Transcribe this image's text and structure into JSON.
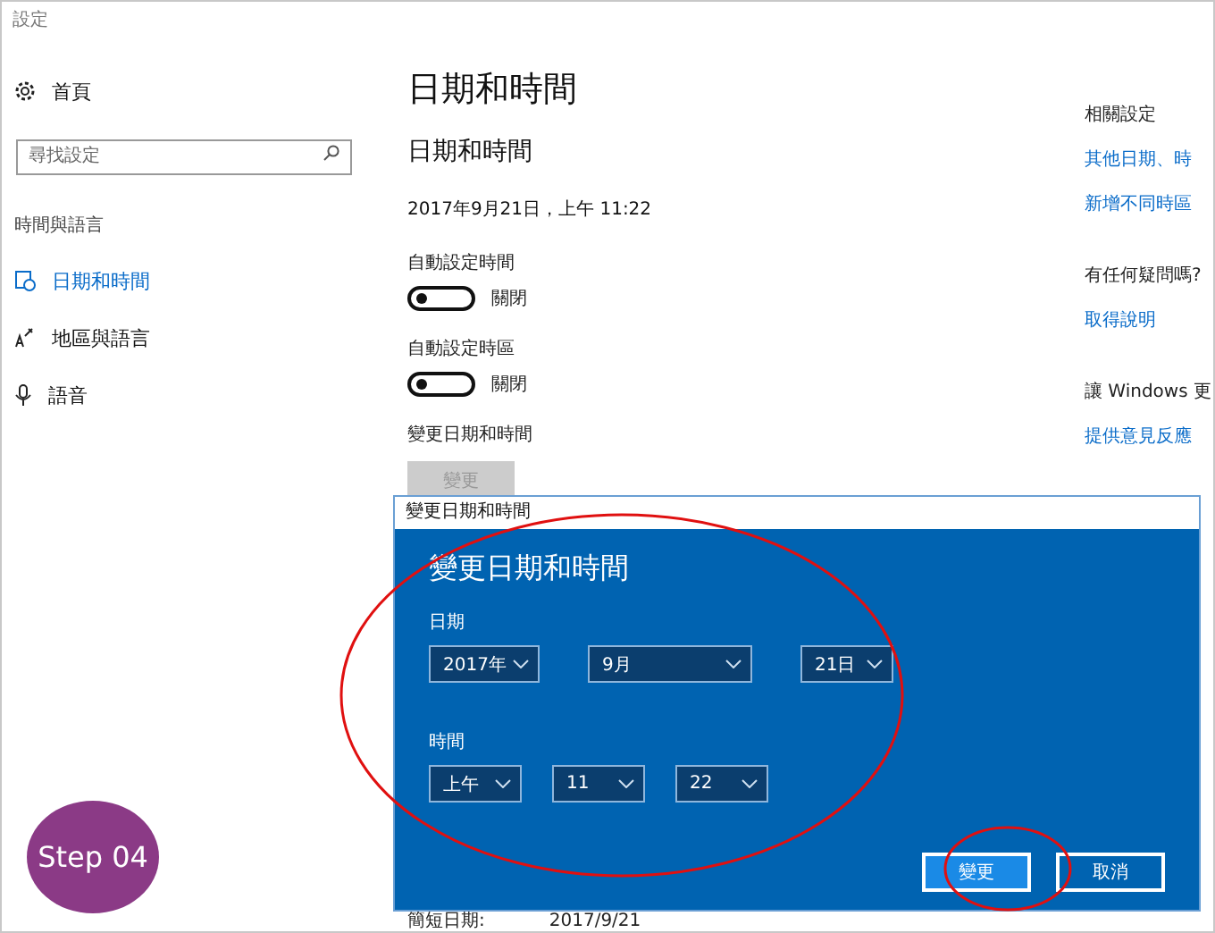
{
  "window": {
    "title": "設定"
  },
  "sidebar": {
    "home": "首頁",
    "search": {
      "placeholder": "尋找設定"
    },
    "section": "時間與語言",
    "items": [
      {
        "label": "日期和時間",
        "kind": "clock",
        "selected": true
      },
      {
        "label": "地區與語言",
        "kind": "language",
        "selected": false
      },
      {
        "label": "語音",
        "kind": "mic",
        "selected": false
      }
    ]
  },
  "main": {
    "page_title": "日期和時間",
    "section_title": "日期和時間",
    "current_datetime": "2017年9月21日，上午 11:22",
    "toggles": [
      {
        "label": "自動設定時間",
        "on": false,
        "state_text": "關閉"
      },
      {
        "label": "自動設定時區",
        "on": false,
        "state_text": "關閉"
      }
    ],
    "change": {
      "label": "變更日期和時間",
      "button": "變更",
      "disabled": true
    },
    "short_date": {
      "label": "簡短日期:",
      "value": "2017/9/21"
    }
  },
  "aside": [
    {
      "title": "相關設定",
      "links": [
        "其他日期、時",
        "新增不同時區"
      ]
    },
    {
      "title": "有任何疑問嗎?",
      "links": [
        "取得說明"
      ]
    },
    {
      "title": "讓 Windows 更",
      "links": [
        "提供意見反應"
      ]
    }
  ],
  "dialog": {
    "title": "變更日期和時間",
    "heading": "變更日期和時間",
    "date_label": "日期",
    "date_fields": [
      "2017年",
      "9月",
      "21日"
    ],
    "time_label": "時間",
    "time_fields": [
      "上午",
      "11",
      "22"
    ],
    "buttons": [
      {
        "label": "變更",
        "primary": true
      },
      {
        "label": "取消",
        "primary": false
      }
    ]
  },
  "badge": "Step 04"
}
